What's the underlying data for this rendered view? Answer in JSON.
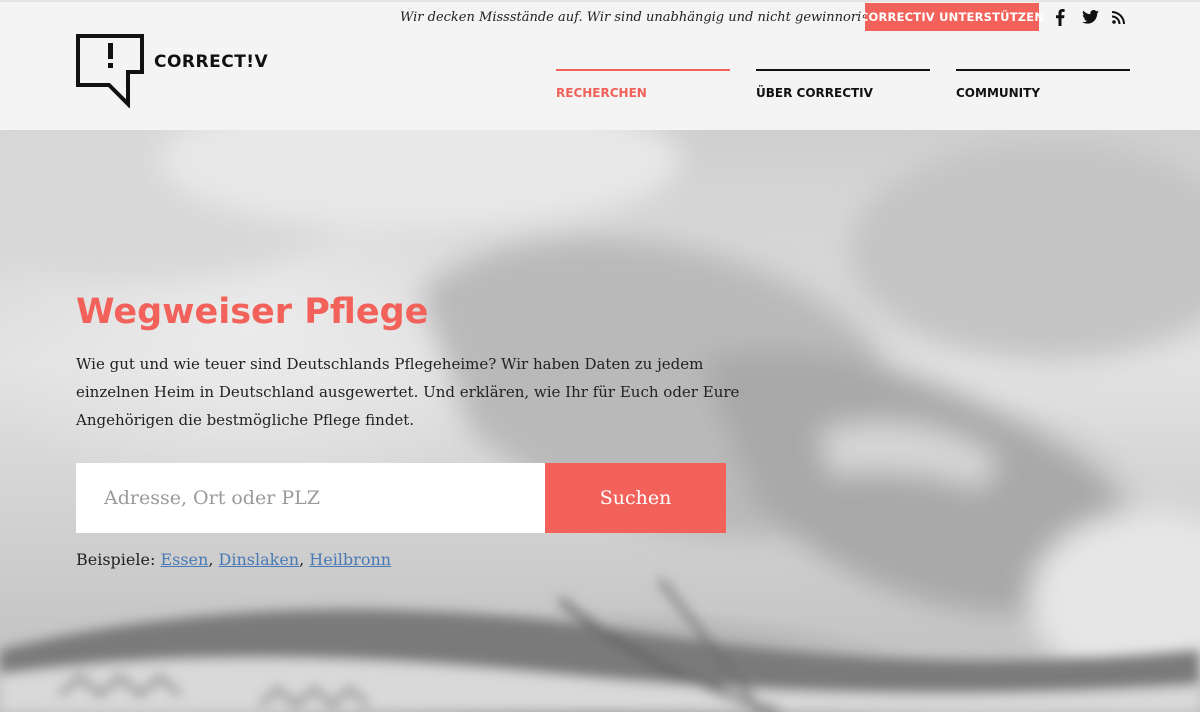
{
  "header": {
    "tagline": "Wir decken Missstände auf. Wir sind unabhängig und nicht gewinnorientiert.",
    "support_button": "CORRECTIV UNTERSTÜTZEN",
    "logo_text": "CORRECT!V",
    "social": [
      {
        "icon": "facebook-icon"
      },
      {
        "icon": "twitter-icon"
      },
      {
        "icon": "rss-icon"
      }
    ],
    "nav": [
      {
        "label": "RECHERCHEN",
        "active": true
      },
      {
        "label": "ÜBER CORRECTIV",
        "active": false
      },
      {
        "label": "COMMUNITY",
        "active": false
      }
    ]
  },
  "hero": {
    "title": "Wegweiser Pflege",
    "description": "Wie gut und wie teuer sind Deutschlands Pflegeheime? Wir haben Daten zu jedem einzelnen Heim in Deutschland ausgewertet. Und erklären, wie Ihr für Euch oder Eure Angehörigen die bestmögliche Pflege findet.",
    "search_placeholder": "Adresse, Ort oder PLZ",
    "search_value": "",
    "search_button": "Suchen",
    "examples_label": "Beispiele:",
    "examples": [
      "Essen",
      "Dinslaken",
      "Heilbronn"
    ]
  },
  "colors": {
    "accent": "#f2625a",
    "link": "#4a7ab5",
    "header_bg": "#f4f4f4"
  }
}
